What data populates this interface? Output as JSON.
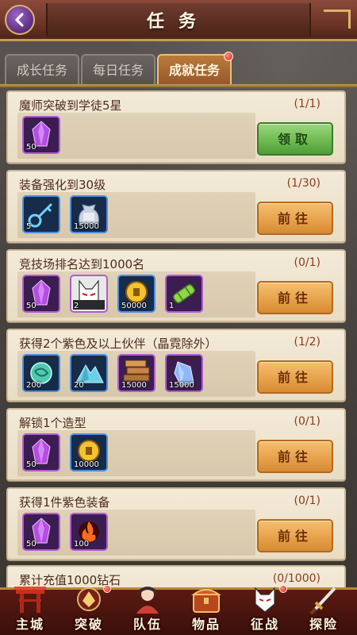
{
  "header": {
    "title": "任务"
  },
  "tabs": [
    {
      "label": "成长任务",
      "active": false
    },
    {
      "label": "每日任务",
      "active": false
    },
    {
      "label": "成就任务",
      "active": true
    }
  ],
  "tasks": [
    {
      "title": "魔师突破到学徒5星",
      "progress": "(1/1)",
      "button": "领取",
      "button_type": "claim",
      "rewards": [
        {
          "icon": "purple-crystal-icon",
          "count": "50",
          "rarity": "purple"
        }
      ]
    },
    {
      "title": "装备强化到30级",
      "progress": "(1/30)",
      "button": "前往",
      "button_type": "go",
      "rewards": [
        {
          "icon": "blue-key-icon",
          "count": "5",
          "rarity": "blue"
        },
        {
          "icon": "money-bag-icon",
          "count": "15000",
          "rarity": "blue"
        }
      ]
    },
    {
      "title": "竞技场排名达到1000名",
      "progress": "(0/1)",
      "button": "前往",
      "button_type": "go",
      "rewards": [
        {
          "icon": "purple-crystal-icon",
          "count": "50",
          "rarity": "purple"
        },
        {
          "icon": "fox-mask-character-icon",
          "count": "2",
          "rarity": "purple"
        },
        {
          "icon": "gold-coin-icon",
          "count": "50000",
          "rarity": "blue"
        },
        {
          "icon": "green-scroll-icon",
          "count": "1",
          "rarity": "purple"
        }
      ]
    },
    {
      "title": "获得2个紫色及以上伙伴（晶霓除外）",
      "progress": "(1/2)",
      "button": "前往",
      "button_type": "go",
      "rewards": [
        {
          "icon": "jade-orb-icon",
          "count": "200",
          "rarity": "blue"
        },
        {
          "icon": "blue-ore-pile-icon",
          "count": "20",
          "rarity": "blue"
        },
        {
          "icon": "wood-planks-icon",
          "count": "15000",
          "rarity": "purple"
        },
        {
          "icon": "blue-crystal-icon",
          "count": "15000",
          "rarity": "purple"
        }
      ]
    },
    {
      "title": "解锁1个造型",
      "progress": "(0/1)",
      "button": "前往",
      "button_type": "go",
      "rewards": [
        {
          "icon": "purple-crystal-icon",
          "count": "50",
          "rarity": "purple"
        },
        {
          "icon": "gold-coin-icon",
          "count": "10000",
          "rarity": "blue"
        }
      ]
    },
    {
      "title": "获得1件紫色装备",
      "progress": "(0/1)",
      "button": "前往",
      "button_type": "go",
      "rewards": [
        {
          "icon": "purple-crystal-icon",
          "count": "50",
          "rarity": "purple"
        },
        {
          "icon": "fire-orb-icon",
          "count": "100",
          "rarity": "purple"
        }
      ]
    },
    {
      "title": "累计充值1000钻石",
      "progress": "(0/1000)",
      "button": "",
      "button_type": "none",
      "rewards": []
    }
  ],
  "nav": [
    {
      "label": "主城",
      "icon": "gate-icon",
      "dot": false
    },
    {
      "label": "突破",
      "icon": "breakthrough-icon",
      "dot": true
    },
    {
      "label": "队伍",
      "icon": "team-icon",
      "dot": false
    },
    {
      "label": "物品",
      "icon": "chest-icon",
      "dot": false
    },
    {
      "label": "征战",
      "icon": "mask-icon",
      "dot": true
    },
    {
      "label": "探险",
      "icon": "sword-icon",
      "dot": false
    }
  ]
}
